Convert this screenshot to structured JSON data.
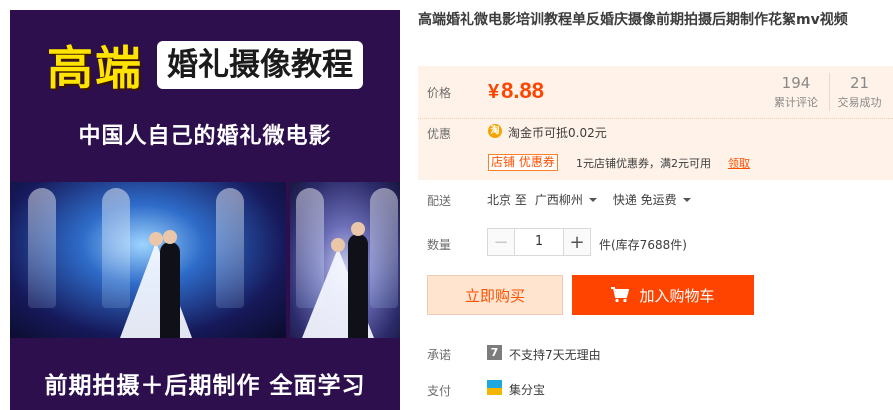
{
  "banner": {
    "title_strong": "高端",
    "title_rest": "婚礼摄像教程",
    "subtitle": "中国人自己的婚礼微电影",
    "footer": "前期拍摄＋后期制作 全面学习"
  },
  "product": {
    "title": "高端婚礼微电影培训教程单反婚庆摄像前期拍摄后期制作花絮mv视频"
  },
  "price": {
    "label": "价格",
    "currency": "¥",
    "value": "8.88",
    "color": "#ff4400"
  },
  "stats": [
    {
      "value": "194",
      "label": "累计评论"
    },
    {
      "value": "21",
      "label": "交易成功"
    }
  ],
  "promotion": {
    "label": "优惠",
    "coin_icon": "coin-icon",
    "coin_glyph": "淘",
    "coin_text": "淘金币可抵0.02元",
    "coupon_badge": "店铺  优惠券",
    "coupon_text": "1元店铺优惠券，满2元可用",
    "coupon_link": "领取"
  },
  "delivery": {
    "label": "配送",
    "origin": "北京 至",
    "destination": "广西柳州",
    "method": "快递 免运费"
  },
  "quantity": {
    "label": "数量",
    "value": "1",
    "minus": "−",
    "plus": "+",
    "stock_text": "件(库存7688件)"
  },
  "actions": {
    "buy_now": "立即购买",
    "add_to_cart": "加入购物车",
    "accent": "#ff4400"
  },
  "promise": {
    "label": "承诺",
    "badge": "7",
    "text": "不支持7天无理由"
  },
  "payment": {
    "label": "支付",
    "text": "集分宝"
  }
}
